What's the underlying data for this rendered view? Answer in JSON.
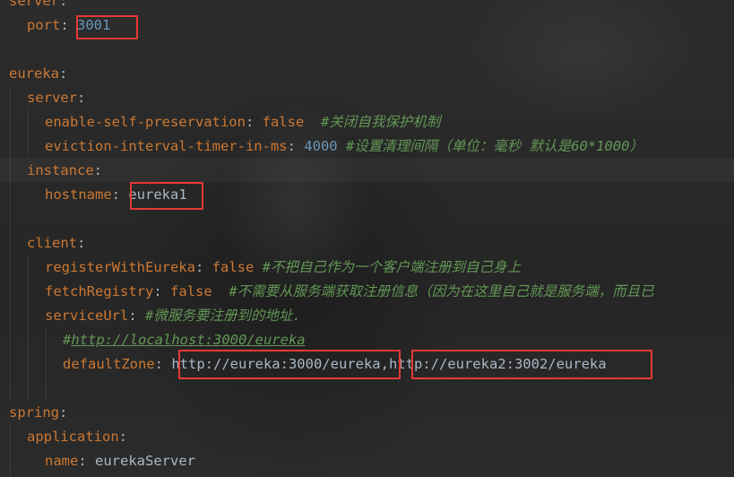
{
  "editor": {
    "lines": {
      "l0": {
        "key": "server",
        "sep": ":"
      },
      "l1": {
        "key": "port",
        "sep": ": ",
        "value": "3001"
      },
      "l3": {
        "key": "eureka",
        "sep": ":"
      },
      "l4": {
        "key": "server",
        "sep": ":"
      },
      "l5": {
        "key": "enable-self-preservation",
        "sep": ": ",
        "value": "false",
        "comment": "#关闭自我保护机制"
      },
      "l6": {
        "key": "eviction-interval-timer-in-ms",
        "sep": ": ",
        "value": "4000",
        "comment": "#设置清理间隔（单位：毫秒 默认是60*1000）"
      },
      "l7": {
        "key": "instance",
        "sep": ":"
      },
      "l8": {
        "key": "hostname",
        "sep": ": ",
        "value": "eureka1"
      },
      "l10": {
        "key": "client",
        "sep": ":"
      },
      "l11": {
        "key": "registerWithEureka",
        "sep": ": ",
        "value": "false",
        "comment": "#不把自己作为一个客户端注册到自己身上"
      },
      "l12": {
        "key": "fetchRegistry",
        "sep": ": ",
        "value": "false",
        "comment": "#不需要从服务端获取注册信息（因为在这里自己就是服务端，而且已"
      },
      "l13": {
        "key": "serviceUrl",
        "sep": ": ",
        "comment": "#微服务要注册到的地址."
      },
      "l14": {
        "comment_prefix": "#",
        "link": "http://localhost:3000/eureka"
      },
      "l15": {
        "key": "defaultZone",
        "sep": ": ",
        "value1": "http://eureka:3000/eureka",
        "comma": ",",
        "value2": "http://eureka2:3002/eureka"
      },
      "l17": {
        "key": "spring",
        "sep": ":"
      },
      "l18": {
        "key": "application",
        "sep": ":"
      },
      "l19": {
        "key": "name",
        "sep": ": ",
        "value": "eurekaServer"
      }
    }
  },
  "colors": {
    "background": "#2b2b2b",
    "key": "#cc7832",
    "text": "#a9b7c6",
    "number": "#6897bb",
    "comment": "#629755",
    "highlight_box": "#e53935"
  }
}
